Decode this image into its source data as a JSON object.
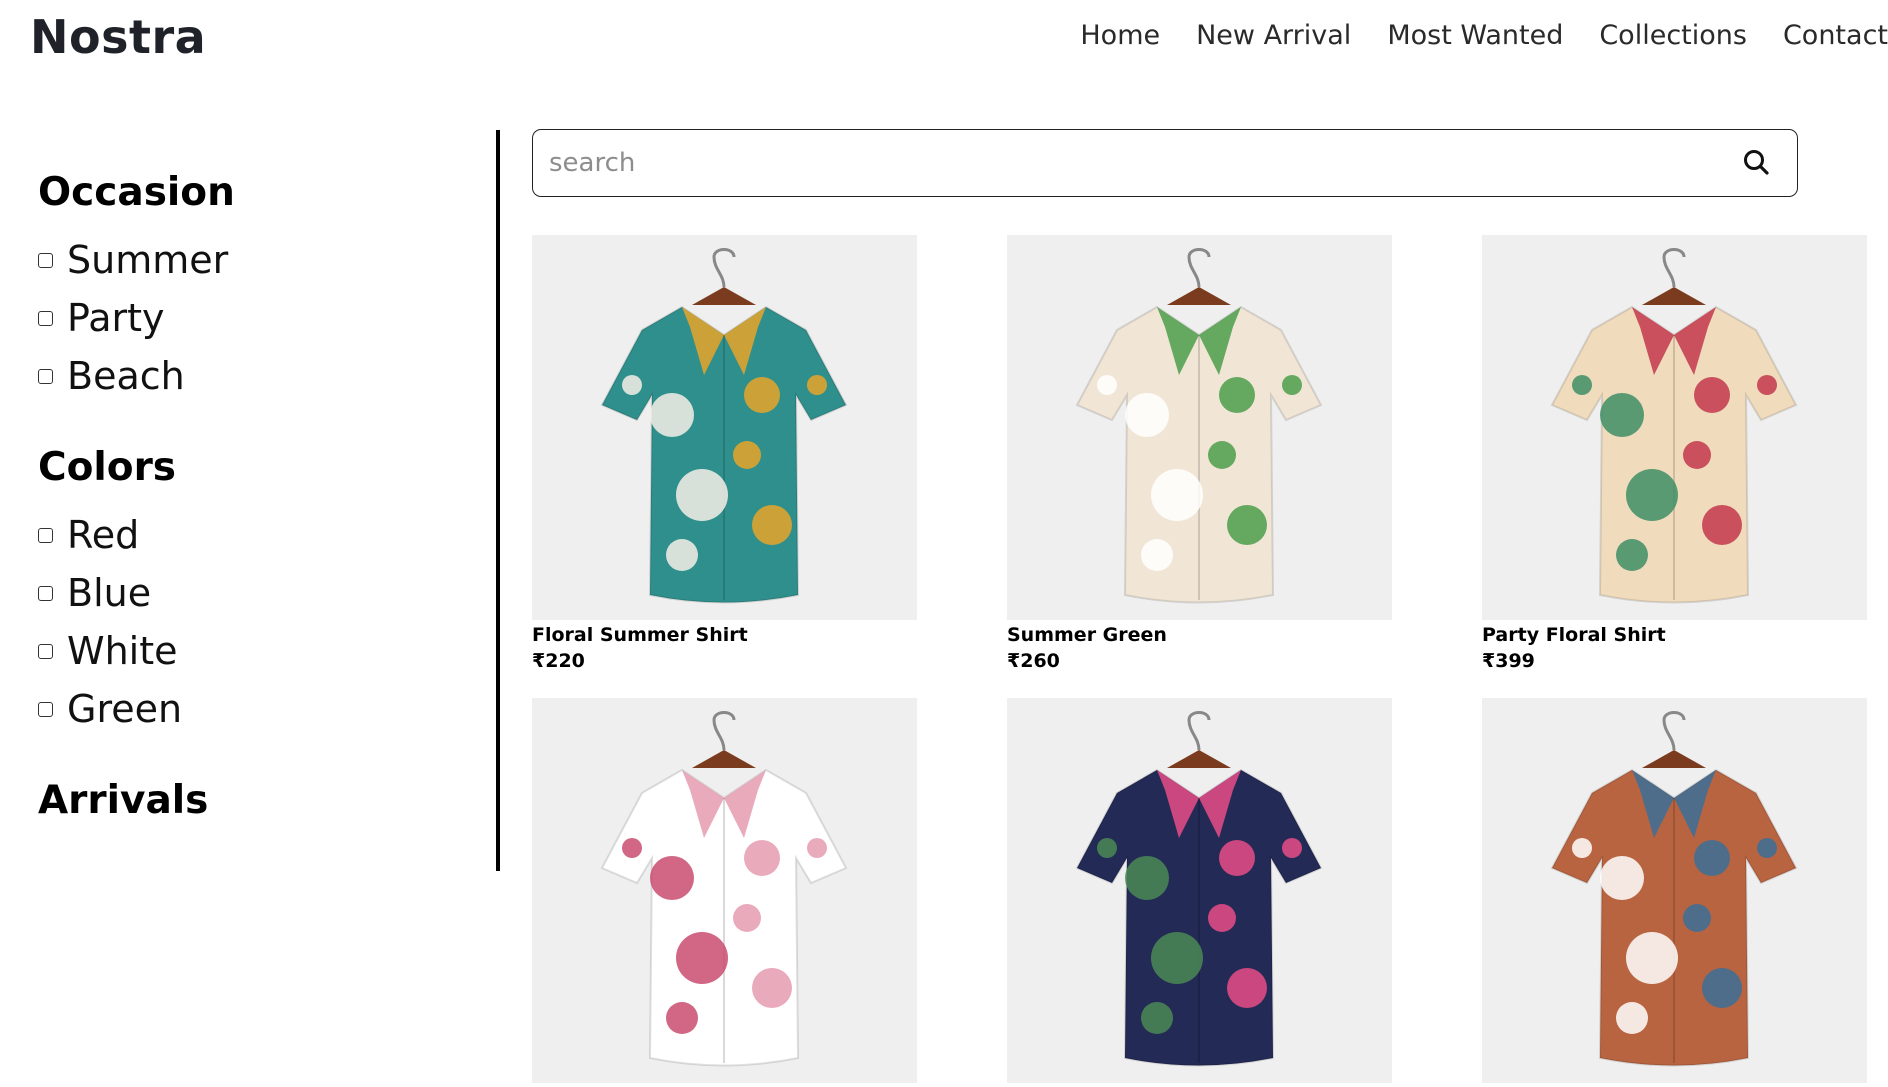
{
  "header": {
    "logo": "Nostra",
    "nav": [
      "Home",
      "New Arrival",
      "Most Wanted",
      "Collections",
      "Contact"
    ]
  },
  "sidebar": {
    "groups": [
      {
        "title": "Occasion",
        "options": [
          "Summer",
          "Party",
          "Beach"
        ]
      },
      {
        "title": "Colors",
        "options": [
          "Red",
          "Blue",
          "White",
          "Green"
        ]
      },
      {
        "title": "Arrivals",
        "options": []
      }
    ]
  },
  "search": {
    "placeholder": "search",
    "icon": "search-icon"
  },
  "products": [
    {
      "name": "Floral Summer Shirt",
      "price": "₹220",
      "colors": [
        "#2f8f8c",
        "#e8a629",
        "#f4f0e6"
      ]
    },
    {
      "name": "Summer Green",
      "price": "₹260",
      "colors": [
        "#f1e6d6",
        "#4c9c4a",
        "#ffffff"
      ]
    },
    {
      "name": "Party Floral Shirt",
      "price": "₹399",
      "colors": [
        "#f0dcbd",
        "#c2374b",
        "#3f8e65"
      ]
    },
    {
      "name": "",
      "price": "",
      "colors": [
        "#ffffff",
        "#e59cb0",
        "#c94c70"
      ]
    },
    {
      "name": "",
      "price": "",
      "colors": [
        "#232a55",
        "#e84c87",
        "#4a8a55"
      ]
    },
    {
      "name": "",
      "price": "",
      "colors": [
        "#b96440",
        "#3a6f99",
        "#ffffff"
      ]
    }
  ]
}
